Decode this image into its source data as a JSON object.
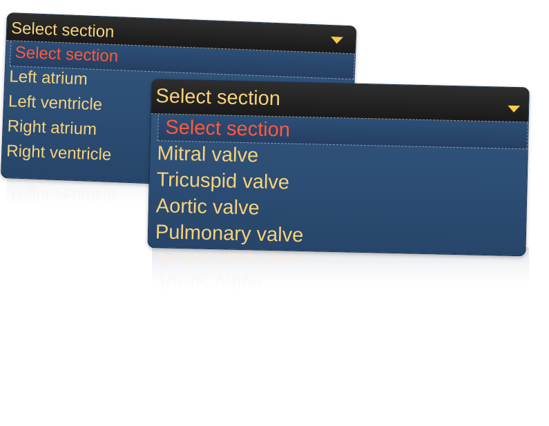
{
  "back_dropdown": {
    "header_label": "Select section",
    "options": [
      "Select section",
      "Left atrium",
      "Left ventricle",
      "Right atrium",
      "Right ventricle"
    ],
    "selected_index": 0,
    "reflection": [
      "Right ventricle",
      "Right atrium"
    ]
  },
  "front_dropdown": {
    "header_label": "Select section",
    "options": [
      "Select section",
      "Mitral valve",
      "Tricuspid valve",
      "Aortic valve",
      "Pulmonary valve"
    ],
    "selected_index": 0,
    "reflection": [
      "Pulmonary valve",
      "Aortic valve"
    ]
  },
  "icons": {
    "dropdown_arrow": "chevron-down-icon"
  },
  "colors": {
    "option_text": "#f7d27a",
    "selected_text": "#ff5a3c",
    "arrow": "#f7c948",
    "panel_bg": "#2f5279",
    "header_bg": "#1f1f1f"
  }
}
